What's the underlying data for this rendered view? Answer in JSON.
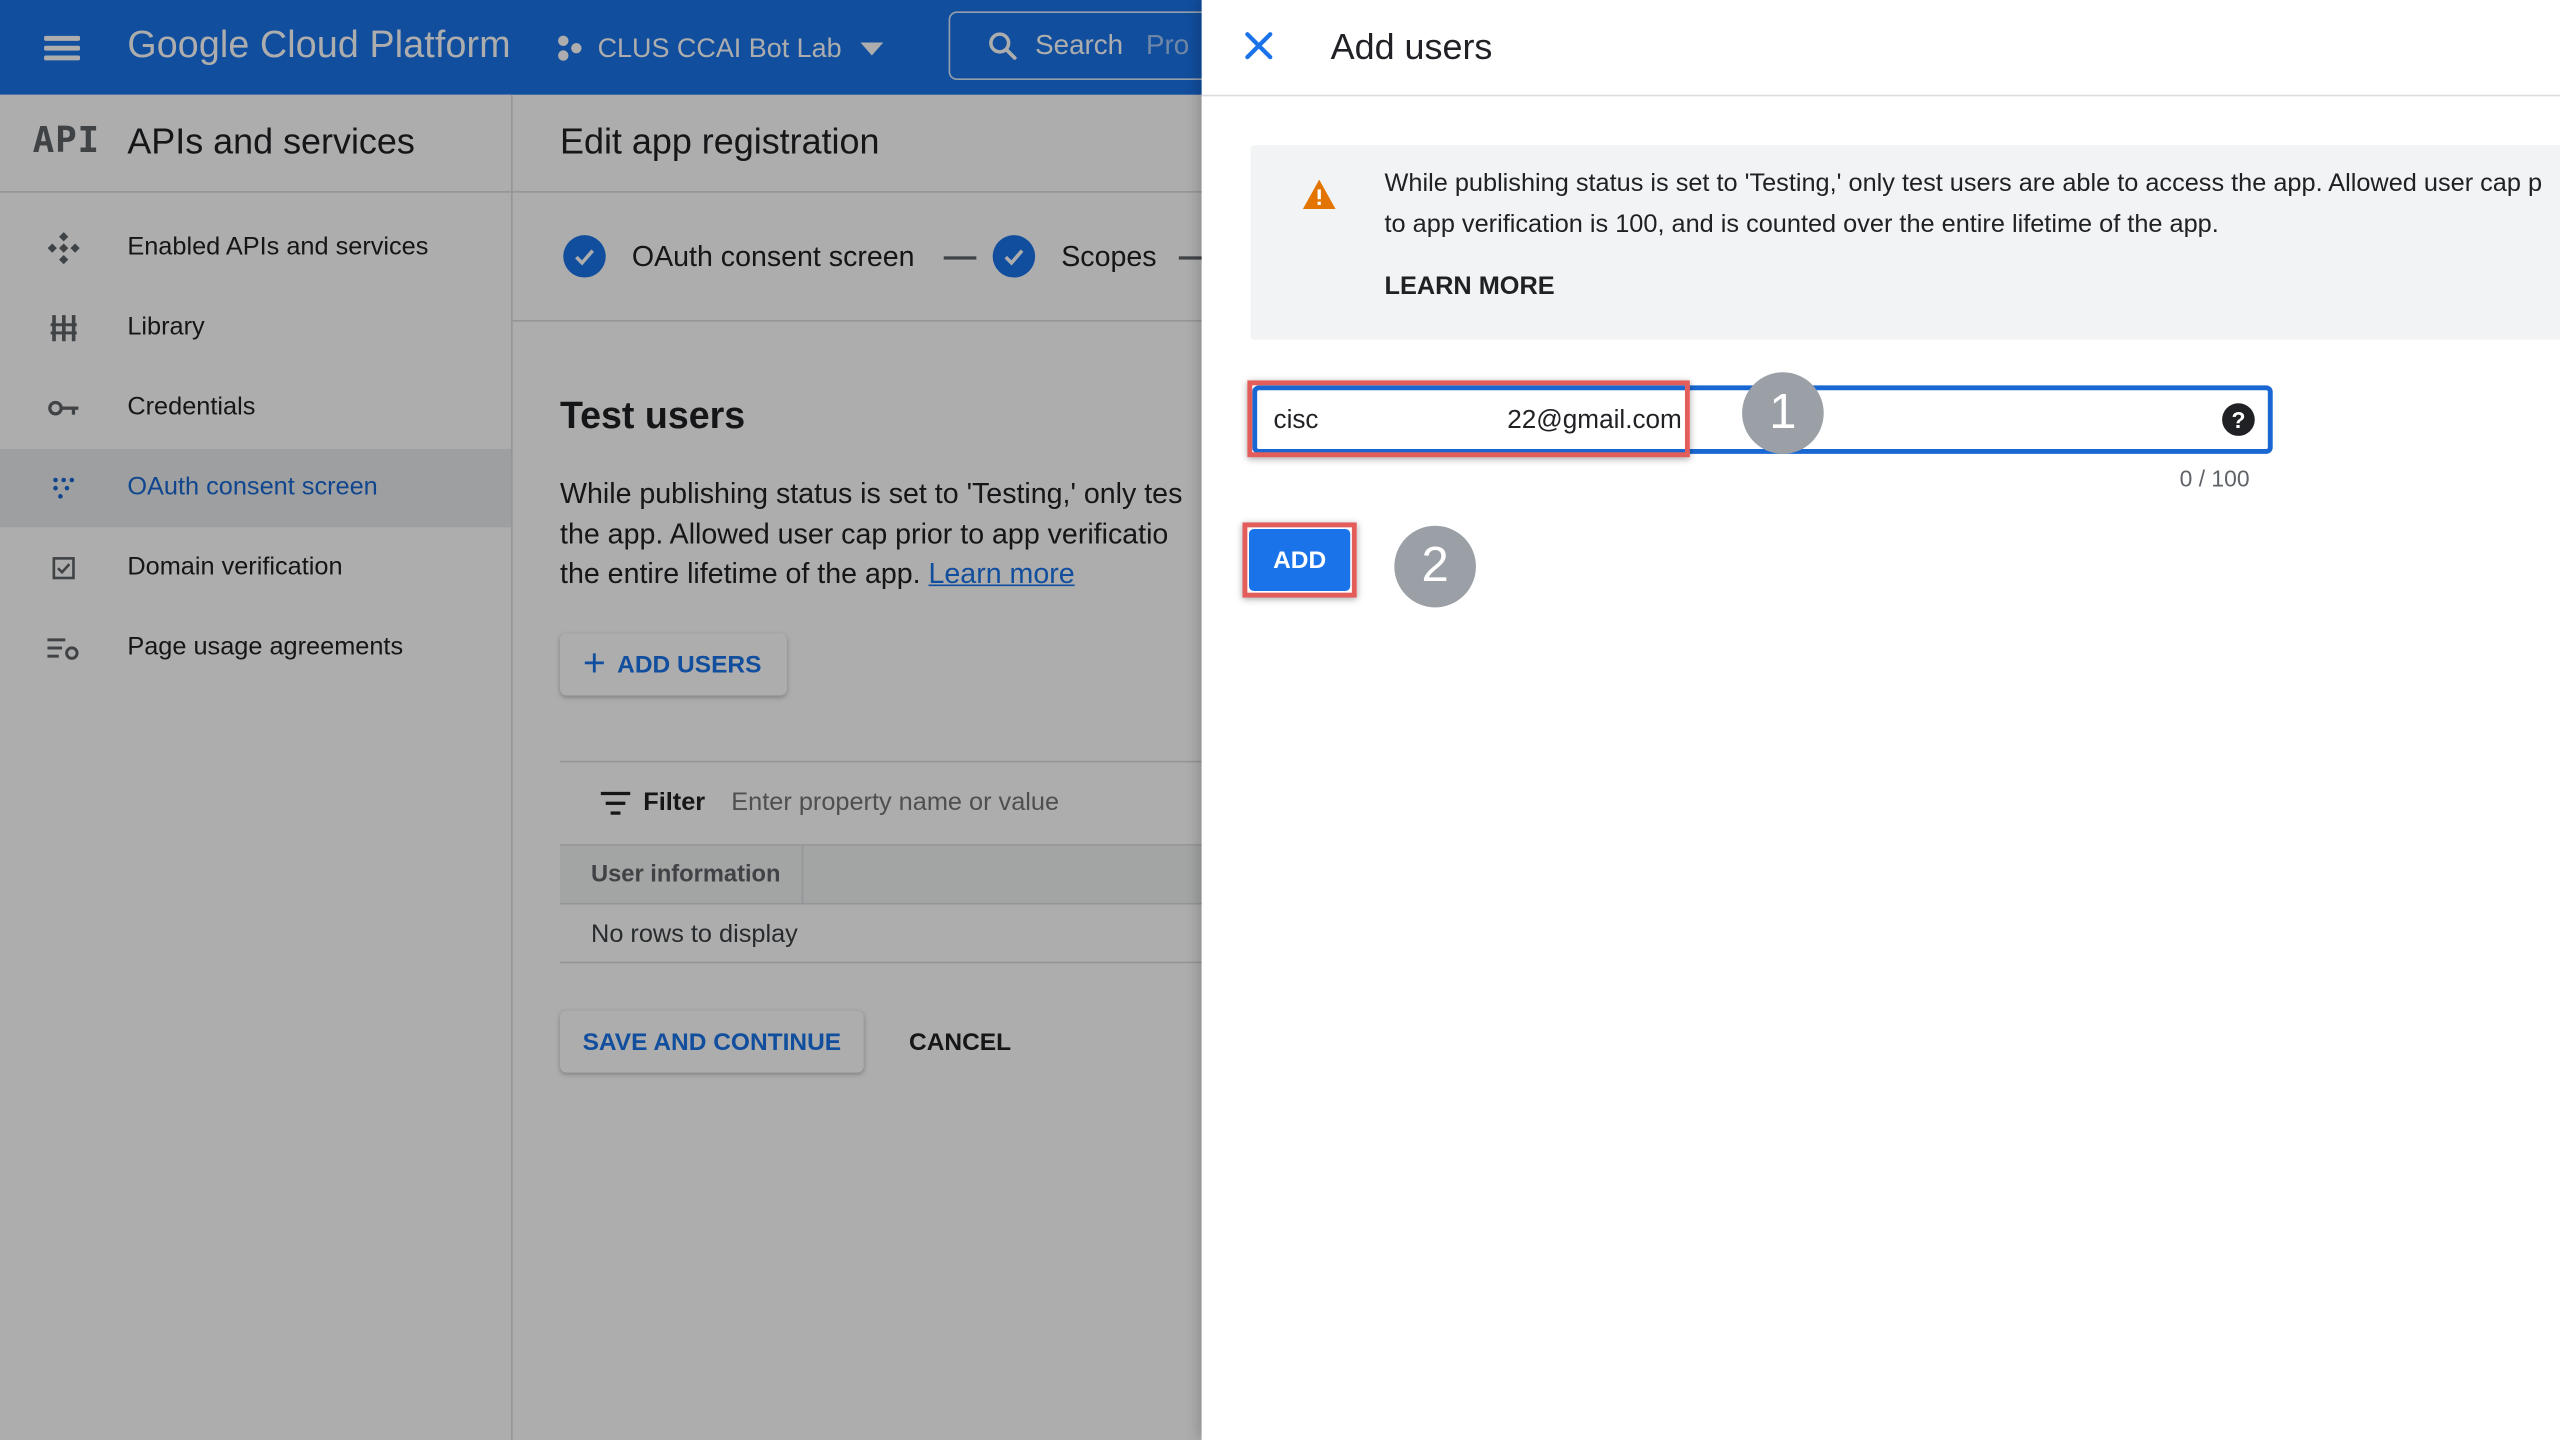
{
  "header": {
    "brand": "Google Cloud Platform",
    "project": "CLUS CCAI Bot Lab",
    "search_label": "Search",
    "search_placeholder": "Pro",
    "accent_color": "#1a73e8"
  },
  "sidebar": {
    "logo_text": "API",
    "title": "APIs and services",
    "items": [
      {
        "label": "Enabled APIs and services",
        "icon": "api-hub-icon"
      },
      {
        "label": "Library",
        "icon": "library-icon"
      },
      {
        "label": "Credentials",
        "icon": "key-icon"
      },
      {
        "label": "OAuth consent screen",
        "icon": "oauth-icon",
        "active": true
      },
      {
        "label": "Domain verification",
        "icon": "checkbox-icon"
      },
      {
        "label": "Page usage agreements",
        "icon": "settings-list-icon"
      }
    ]
  },
  "main": {
    "title": "Edit app registration",
    "steps": [
      {
        "label": "OAuth consent screen",
        "done": true
      },
      {
        "label": "Scopes",
        "done": true
      }
    ],
    "test_users": {
      "title": "Test users",
      "desc_lines": [
        "While publishing status is set to 'Testing,' only tes",
        "the app. Allowed user cap prior to app verificatio",
        "the entire lifetime of the app. "
      ],
      "learn_more": "Learn more",
      "add_users_label": "ADD USERS"
    },
    "table": {
      "filter_label": "Filter",
      "filter_placeholder": "Enter property name or value",
      "columns": [
        "User information"
      ],
      "empty_text": "No rows to display"
    },
    "save_continue_label": "SAVE AND CONTINUE",
    "cancel_label": "CANCEL"
  },
  "drawer": {
    "title": "Add users",
    "banner": {
      "line1": "While publishing status is set to 'Testing,' only test users are able to access the app. Allowed user cap p",
      "line2": "to app verification is 100, and is counted over the entire lifetime of the app.",
      "learn_more": "LEARN MORE",
      "warning_color": "#e37400"
    },
    "email_field": {
      "value": "cisc                          22@gmail.com",
      "counter": "0 / 100",
      "help": "?"
    },
    "add_label": "ADD",
    "markers": [
      "1",
      "2"
    ],
    "highlight_color": "#e35d5b"
  }
}
